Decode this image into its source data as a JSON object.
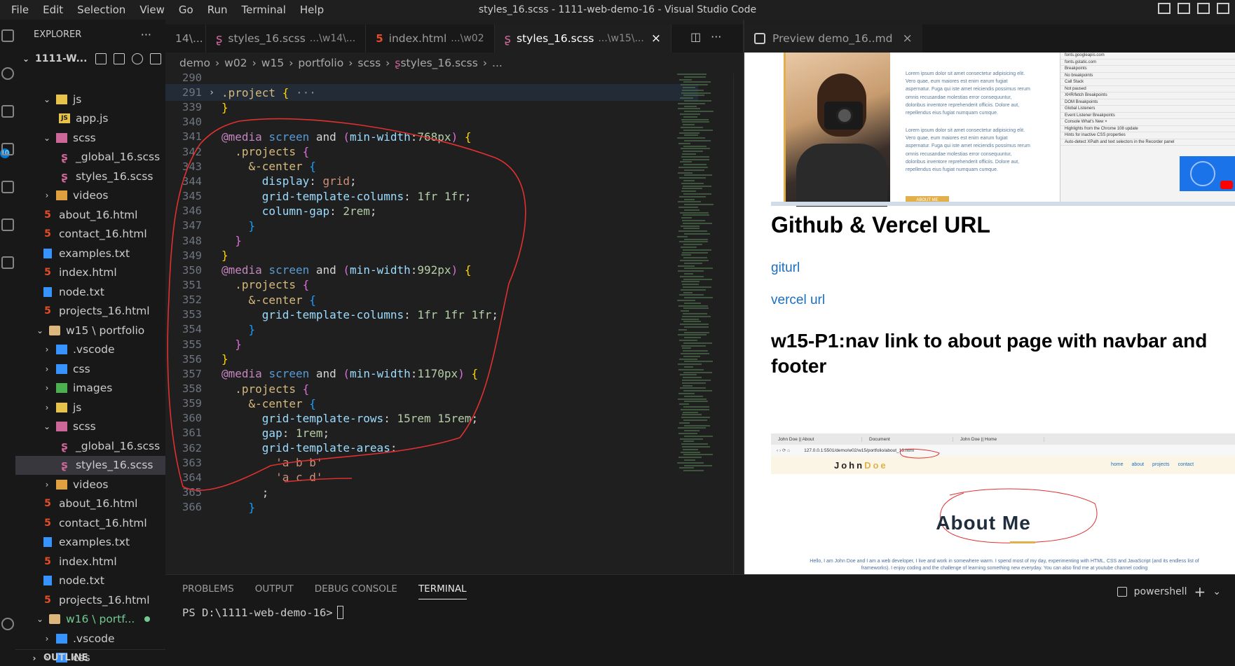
{
  "window": {
    "title": "styles_16.scss - 1111-web-demo-16 - Visual Studio Code",
    "menu": [
      "File",
      "Edit",
      "Selection",
      "View",
      "Go",
      "Run",
      "Terminal",
      "Help"
    ]
  },
  "activity": {
    "badge": "10"
  },
  "explorer": {
    "header": "EXPLORER",
    "more": "···",
    "folder_name": "1111-W...",
    "tree": [
      {
        "name": "js",
        "kind": "folder-js",
        "chevron": "⌄",
        "depth": 3
      },
      {
        "name": "app.js",
        "kind": "js",
        "depth": 4
      },
      {
        "name": "scss",
        "kind": "folder-scss",
        "chevron": "⌄",
        "depth": 3
      },
      {
        "name": "_global_16.scss",
        "kind": "sass",
        "depth": 4
      },
      {
        "name": "styles_16.scss",
        "kind": "sass",
        "depth": 4
      },
      {
        "name": "videos",
        "kind": "folder-vid",
        "chevron": "›",
        "depth": 3
      },
      {
        "name": "about_16.html",
        "kind": "html",
        "depth": 3
      },
      {
        "name": "contact_16.html",
        "kind": "html",
        "depth": 3
      },
      {
        "name": "examples.txt",
        "kind": "txt",
        "depth": 3
      },
      {
        "name": "index.html",
        "kind": "html",
        "depth": 3
      },
      {
        "name": "node.txt",
        "kind": "txt",
        "depth": 3
      },
      {
        "name": "projects_16.html",
        "kind": "html",
        "depth": 3
      },
      {
        "name": "w15 \\ portfolio",
        "kind": "folder",
        "chevron": "⌄",
        "depth": 2
      },
      {
        "name": ".vscode",
        "kind": "folder-vs",
        "chevron": "›",
        "depth": 3
      },
      {
        "name": "css",
        "kind": "folder-css",
        "chevron": "›",
        "depth": 3
      },
      {
        "name": "images",
        "kind": "folder-img",
        "chevron": "›",
        "depth": 3
      },
      {
        "name": "js",
        "kind": "folder-js",
        "chevron": "›",
        "depth": 3
      },
      {
        "name": "scss",
        "kind": "folder-scss",
        "chevron": "⌄",
        "depth": 3
      },
      {
        "name": "_global_16.scss",
        "kind": "sass",
        "depth": 4
      },
      {
        "name": "styles_16.scss",
        "kind": "sass",
        "depth": 4,
        "selected": true
      },
      {
        "name": "videos",
        "kind": "folder-vid",
        "chevron": "›",
        "depth": 3
      },
      {
        "name": "about_16.html",
        "kind": "html",
        "depth": 3
      },
      {
        "name": "contact_16.html",
        "kind": "html",
        "depth": 3
      },
      {
        "name": "examples.txt",
        "kind": "txt",
        "depth": 3
      },
      {
        "name": "index.html",
        "kind": "html",
        "depth": 3
      },
      {
        "name": "node.txt",
        "kind": "txt",
        "depth": 3
      },
      {
        "name": "projects_16.html",
        "kind": "html",
        "depth": 3
      },
      {
        "name": "w16 \\ portf...",
        "kind": "folder",
        "chevron": "⌄",
        "depth": 2,
        "modified": true,
        "color": "#73c991"
      },
      {
        "name": ".vscode",
        "kind": "folder-vs",
        "chevron": "›",
        "depth": 3
      },
      {
        "name": "css",
        "kind": "folder-css",
        "chevron": "›",
        "depth": 3
      }
    ],
    "outline": "OUTLINE"
  },
  "editor": {
    "tabs": [
      {
        "name": "14\\...",
        "desc": "",
        "icon": "",
        "active": false
      },
      {
        "name": "styles_16.scss",
        "desc": "...\\w14\\...",
        "icon": "sass",
        "active": false
      },
      {
        "name": "index.html",
        "desc": "...\\w02",
        "icon": "html",
        "active": false
      },
      {
        "name": "styles_16.scss",
        "desc": "...\\w15\\...",
        "icon": "sass",
        "active": true
      }
    ],
    "breadcrumb": [
      "demo",
      "w02",
      "w15",
      "portfolio",
      "scss",
      "styles_16.scss",
      "..."
    ],
    "lines": [
      {
        "n": "290",
        "html": ""
      },
      {
        "n": "291",
        "fold": "›",
        "hl": true,
        "html": "<span class='t-sel'>.project</span> <span class='t-b1'>{</span> <span class='t-fold'>···</span>"
      },
      {
        "n": "339",
        "html": "<span class='t-b1'>}</span>"
      },
      {
        "n": "340",
        "html": ""
      },
      {
        "n": "341",
        "html": "<span class='t-at'>@media</span> <span class='t-kw'>screen</span> and <span class='t-b2'>(</span><span class='t-prop'>min-width</span>:<span class='t-num'>768px</span><span class='t-b2'>)</span> <span class='t-b1'>{</span>"
      },
      {
        "n": "342",
        "html": "  <span class='t-sel'>.projects</span> <span class='t-b2'>{</span>"
      },
      {
        "n": "343",
        "html": "    <span class='t-sel'>&amp;-center</span> <span class='t-b3'>{</span>"
      },
      {
        "n": "344",
        "html": "      <span class='t-prop'>display</span>: <span class='t-val'>grid</span>;"
      },
      {
        "n": "345",
        "html": "      <span class='t-prop'>grid-template-columns</span>: <span class='t-num'>1fr</span> <span class='t-num'>1fr</span>;"
      },
      {
        "n": "346",
        "html": "      <span class='t-prop'>column-gap</span>: <span class='t-num'>2rem</span>;"
      },
      {
        "n": "347",
        "html": "    <span class='t-b3'>}</span>"
      },
      {
        "n": "348",
        "html": "  <span class='t-b2'>}</span>"
      },
      {
        "n": "349",
        "html": "<span class='t-b1'>}</span>"
      },
      {
        "n": "350",
        "html": "<span class='t-at'>@media</span> <span class='t-kw'>screen</span> and <span class='t-b2'>(</span><span class='t-prop'>min-width</span>:<span class='t-num'>992px</span><span class='t-b2'>)</span> <span class='t-b1'>{</span>"
      },
      {
        "n": "351",
        "html": "  <span class='t-sel'>.projects</span> <span class='t-b2'>{</span>"
      },
      {
        "n": "352",
        "html": "    <span class='t-sel'>&amp;-center</span> <span class='t-b3'>{</span>"
      },
      {
        "n": "353",
        "html": "      <span class='t-prop'>grid-template-columns</span>: <span class='t-num'>1fr</span> <span class='t-num'>1fr</span> <span class='t-num'>1fr</span>;"
      },
      {
        "n": "354",
        "html": "    <span class='t-b3'>}</span>"
      },
      {
        "n": "355",
        "html": "  <span class='t-b2'>}</span>"
      },
      {
        "n": "356",
        "html": "<span class='t-b1'>}</span>"
      },
      {
        "n": "357",
        "html": "<span class='t-at'>@media</span> <span class='t-kw'>screen</span> and <span class='t-b2'>(</span><span class='t-prop'>min-width</span>:<span class='t-num'>1170px</span><span class='t-b2'>)</span> <span class='t-b1'>{</span>"
      },
      {
        "n": "358",
        "html": "  <span class='t-sel'>.projects</span> <span class='t-b2'>{</span>"
      },
      {
        "n": "359",
        "html": "    <span class='t-sel'>&amp;-center</span> <span class='t-b3'>{</span>"
      },
      {
        "n": "360",
        "html": "      <span class='t-prop'>grid-template-rows</span>: <span class='t-num'>15rem</span> <span class='t-num'>15rem</span>;"
      },
      {
        "n": "361",
        "html": "      <span class='t-prop'>gap</span>: <span class='t-num'>1rem</span>;"
      },
      {
        "n": "362",
        "html": "      <span class='t-prop'>grid-template-areas</span>:"
      },
      {
        "n": "363",
        "html": "        <span class='t-val'>'a b b'</span>"
      },
      {
        "n": "364",
        "html": "        <span class='t-val'>'a c d'</span>"
      },
      {
        "n": "365",
        "html": "      ;"
      },
      {
        "n": "366",
        "html": "    <span class='t-b3'>}</span>"
      }
    ]
  },
  "preview": {
    "tab_label": "Preview demo_16..md",
    "shot1_para1": "Lorem ipsum dolor sit amet consectetur adipisicing elit. Vero quae, eum maiores est enim earum fugiat aspernatur. Fuga qui iste amet reiciendis possimus rerum omnis recusandae molestias error consequuntur, doloribus inventore reprehenderit officiis. Dolore aut, repellendus eius fugiat numquam cumque.",
    "shot1_para2": "Lorem ipsum dolor sit amet consectetur adipisicing elit. Vero quae, eum maiores est enim earum fugiat aspernatur. Fuga qui iste amet reiciendis possimus rerum omnis recusandae molestias error consequuntur, doloribus inventore reprehenderit officiis. Dolore aut, repellendus eius fugiat numquam cumque.",
    "shot1_button": "ABOUT ME",
    "devtools_rows": [
      "fonts.googleapis.com",
      "fonts.gstatic.com",
      "Breakpoints",
      "No breakpoints",
      "Call Stack",
      "Not paused",
      "XHR/fetch Breakpoints",
      "DOM Breakpoints",
      "Global Listeners",
      "Event Listener Breakpoints",
      "Console   What's New ×",
      "Highlights from the Chrome 108 update",
      "Hints for inactive CSS properties",
      "Auto-detect XPath and text selectors in the Recorder panel"
    ],
    "heading1": "Github & Vercel URL",
    "link1": "giturl",
    "link2": "vercel url",
    "heading2": "w15-P1:nav link to about page with navbar and footer",
    "shot2_tabs": [
      "John Doe || About",
      "Document",
      "John Doe || Home"
    ],
    "shot2_url": "127.0.0.1:5501/demo/w02/w15/portfolio/about_16.html",
    "shot2_logo_a": "John",
    "shot2_logo_b": "Doe",
    "shot2_menu": [
      "home",
      "about",
      "projects",
      "contact"
    ],
    "shot2_about": "About Me",
    "shot2_text": "Hello, I am John Doe and I am a web developer, I live and work in somewhere warm. I spend most of my day, experimenting with HTML, CSS and JavaScript (and its endless list of frameworks). I enjoy coding and the challenge of learning something new everyday. You can also find me at youtube channel coding"
  },
  "panel": {
    "tabs": [
      "PROBLEMS",
      "OUTPUT",
      "DEBUG CONSOLE",
      "TERMINAL"
    ],
    "active_tab": "TERMINAL",
    "shell": "powershell",
    "add": "+",
    "prompt": "PS D:\\1111-web-demo-16>"
  },
  "colors": {
    "annotation": "#e03030",
    "accent": "#0078d4"
  }
}
